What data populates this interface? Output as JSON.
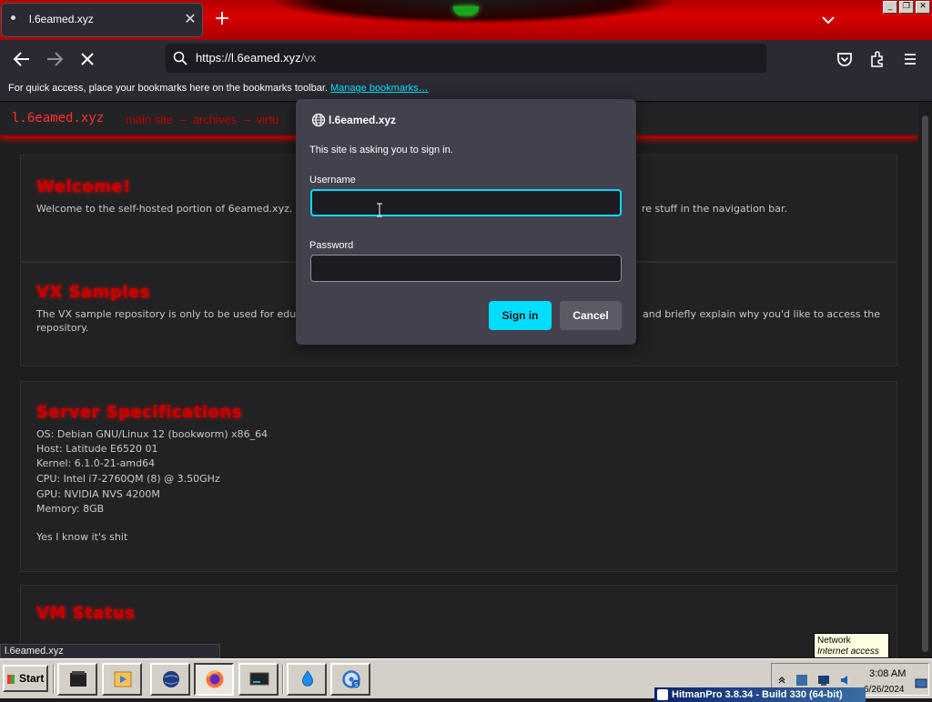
{
  "browser": {
    "tab": {
      "title": "l.6eamed.xyz",
      "close": "✕"
    },
    "new_tab": "+",
    "url": {
      "host": "https://l.6eamed.xyz",
      "path": "/vx"
    },
    "bookmarks_bar": {
      "message": "For quick access, place your bookmarks here on the bookmarks toolbar.",
      "link": "Manage bookmarks…"
    },
    "status_url": "l.6eamed.xyz",
    "window_buttons": [
      "_",
      "❐",
      "✕"
    ]
  },
  "site": {
    "logo": "l.6eamed.xyz",
    "nav": "main site  –  archives  –  virtu",
    "welcome": {
      "title": "Welcome!",
      "text_left": "Welcome to the self-hosted portion of 6eamed.xyz. Mos",
      "text_right": "re stuff in the navigation bar."
    },
    "vx": {
      "title": "VX Samples",
      "text_left": "The VX sample repository is only to be used for educat",
      "text_right": "and briefly explain why you'd like to access the",
      "text_line2": "repository."
    },
    "specs": {
      "title": "Server Specifications",
      "lines": [
        "OS: Debian GNU/Linux 12 (bookworm) x86_64",
        "Host: Latitude E6520 01",
        "Kernel: 6.1.0-21-amd64",
        "CPU: Intel i7-2760QM (8) @ 3.50GHz",
        "GPU: NVIDIA NVS 4200M",
        "Memory: 8GB"
      ],
      "note": "Yes I know it's shit"
    },
    "vm": {
      "title": "VM Status"
    }
  },
  "dialog": {
    "site": "l.6eamed.xyz",
    "message": "This site is asking you to sign in.",
    "username_label": "Username",
    "username_value": "",
    "password_label": "Password",
    "password_value": "",
    "sign_in": "Sign in",
    "cancel": "Cancel"
  },
  "tooltip": {
    "title": "Network",
    "status": "Internet access"
  },
  "taskbar": {
    "start": "Start",
    "time": "3:08 AM",
    "date": "6/26/2024",
    "hitman": "HitmanPro 3.8.34 - Build 330 (64-bit)"
  },
  "colors": {
    "accent": "#00ddff",
    "brand_red": "#c40000",
    "chrome_dark": "#2b2a33"
  }
}
